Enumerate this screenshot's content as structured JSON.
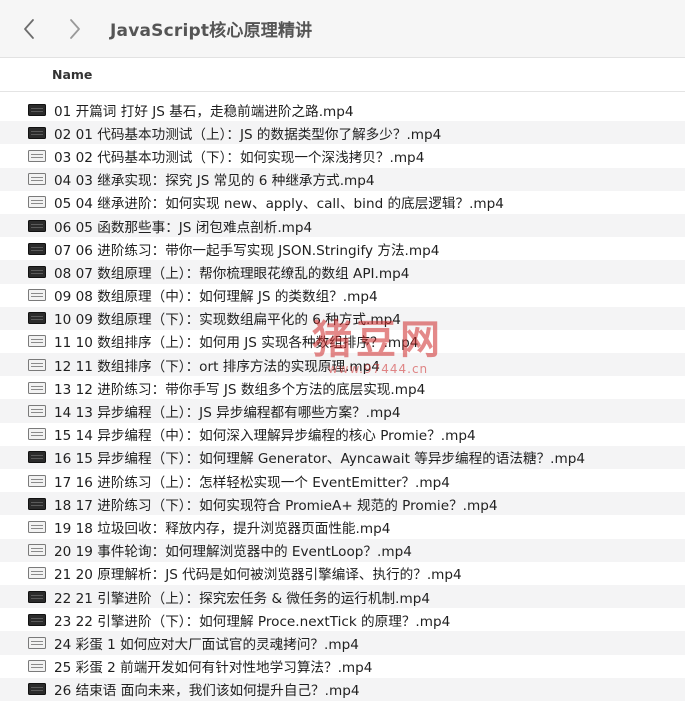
{
  "window": {
    "title": "JavaScript核心原理精讲"
  },
  "colors": {
    "titlebar_bg": "#f6f6f6",
    "stripe_bg": "#f4f4f5",
    "watermark": "#cd2828"
  },
  "list": {
    "column_name": "Name",
    "files": [
      {
        "name": "01 开篇词  打好 JS 基石，走稳前端进阶之路.mp4",
        "icon": "video-file-icon-dark"
      },
      {
        "name": "02 01  代码基本功测试（上）：JS 的数据类型你了解多少？.mp4",
        "icon": "video-file-icon-dark"
      },
      {
        "name": "03 02  代码基本功测试（下）：如何实现一个深浅拷贝？.mp4",
        "icon": "video-file-icon-light"
      },
      {
        "name": "04 03  继承实现：探究 JS 常见的 6 种继承方式.mp4",
        "icon": "video-file-icon-light"
      },
      {
        "name": "05 04  继承进阶：如何实现 new、apply、call、bind 的底层逻辑？.mp4",
        "icon": "video-file-icon-light"
      },
      {
        "name": "06 05  函数那些事：JS 闭包难点剖析.mp4",
        "icon": "video-file-icon-dark"
      },
      {
        "name": "07 06  进阶练习：带你一起手写实现 JSON.Stringify 方法.mp4",
        "icon": "video-file-icon-dark"
      },
      {
        "name": "08 07  数组原理（上）：帮你梳理眼花缭乱的数组 API.mp4",
        "icon": "video-file-icon-dark"
      },
      {
        "name": "09 08  数组原理（中）：如何理解 JS 的类数组？.mp4",
        "icon": "video-file-icon-light"
      },
      {
        "name": "10 09  数组原理（下）：实现数组扁平化的 6 种方式.mp4",
        "icon": "video-file-icon-dark"
      },
      {
        "name": "11 10  数组排序（上）：如何用 JS 实现各种数组排序？.mp4",
        "icon": "video-file-icon-light"
      },
      {
        "name": "12 11  数组排序（下）：ort 排序方法的实现原理.mp4",
        "icon": "video-file-icon-light"
      },
      {
        "name": "13 12  进阶练习：带你手写 JS 数组多个方法的底层实现.mp4",
        "icon": "video-file-icon-light"
      },
      {
        "name": "14 13  异步编程（上）：JS 异步编程都有哪些方案？.mp4",
        "icon": "video-file-icon-light"
      },
      {
        "name": "15 14  异步编程（中）：如何深入理解异步编程的核心 Promie？.mp4",
        "icon": "video-file-icon-light"
      },
      {
        "name": "16 15  异步编程（下）：如何理解 Generator、Ayncawait 等异步编程的语法糖？.mp4",
        "icon": "video-file-icon-dark"
      },
      {
        "name": "17 16  进阶练习（上）：怎样轻松实现一个 EventEmitter？.mp4",
        "icon": "video-file-icon-light"
      },
      {
        "name": "18 17  进阶练习（下）：如何实现符合 PromieA+ 规范的 Promie？.mp4",
        "icon": "video-file-icon-dark"
      },
      {
        "name": "19 18  垃圾回收：释放内存，提升浏览器页面性能.mp4",
        "icon": "video-file-icon-light"
      },
      {
        "name": "20 19  事件轮询：如何理解浏览器中的 EventLoop？.mp4",
        "icon": "video-file-icon-light"
      },
      {
        "name": "21 20  原理解析：JS 代码是如何被浏览器引擎编译、执行的？.mp4",
        "icon": "video-file-icon-light"
      },
      {
        "name": "22 21  引擎进阶（上）：探究宏任务 & 微任务的运行机制.mp4",
        "icon": "video-file-icon-dark"
      },
      {
        "name": "23 22  引擎进阶（下）：如何理解 Proce.nextTick 的原理？.mp4",
        "icon": "video-file-icon-dark"
      },
      {
        "name": "24 彩蛋 1  如何应对大厂面试官的灵魂拷问？.mp4",
        "icon": "video-file-icon-light"
      },
      {
        "name": "25 彩蛋 2  前端开发如何有针对性地学习算法？.mp4",
        "icon": "video-file-icon-light"
      },
      {
        "name": "26 结束语  面向未来，我们该如何提升自己？.mp4",
        "icon": "video-file-icon-dark"
      }
    ]
  },
  "watermark": {
    "main": "猪豆网",
    "url": "www.97444.cn"
  }
}
